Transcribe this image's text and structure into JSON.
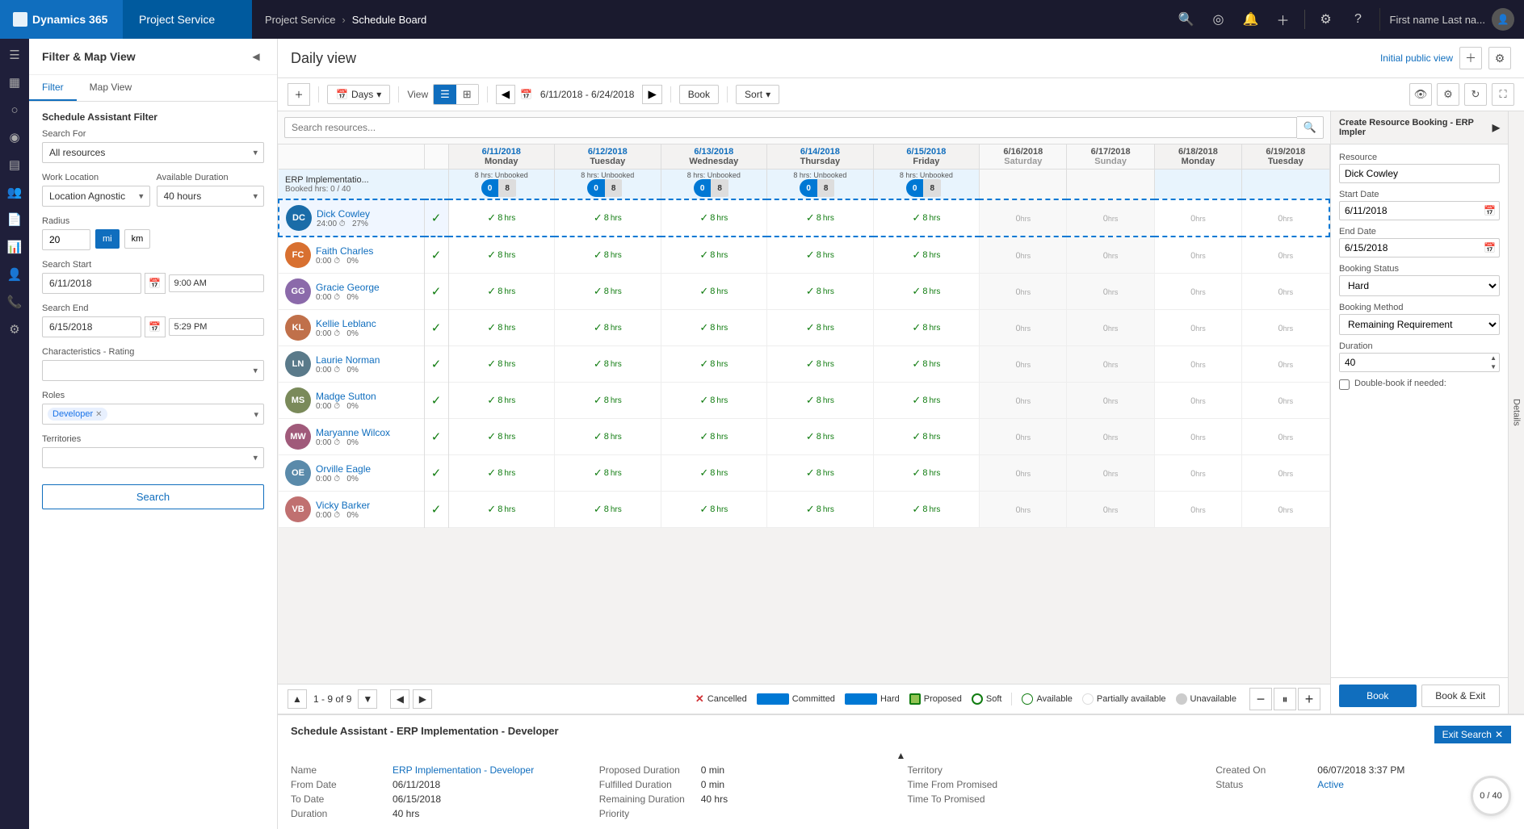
{
  "topnav": {
    "brand": "Dynamics 365",
    "app": "Project Service",
    "breadcrumb_app": "Project Service",
    "breadcrumb_sep": ">",
    "breadcrumb_page": "Schedule Board",
    "user": "First name Last na...",
    "icons": [
      "search",
      "settings",
      "question",
      "plus",
      "gear",
      "help"
    ]
  },
  "page": {
    "title": "Daily view",
    "initial_public": "Initial public view",
    "add_label": "+",
    "gear_label": "⚙"
  },
  "toolbar": {
    "days_label": "Days",
    "view_label": "View",
    "date_range": "6/11/2018 - 6/24/2018",
    "book_label": "Book",
    "sort_label": "Sort"
  },
  "filter_panel": {
    "title": "Filter & Map View",
    "tab_filter": "Filter",
    "tab_map": "Map View",
    "section_title": "Schedule Assistant Filter",
    "search_for_label": "Search For",
    "search_for_value": "All resources",
    "work_location_label": "Work Location",
    "work_location_value": "Location Agnostic",
    "available_duration_label": "Available Duration",
    "available_duration_value": "40 hours",
    "radius_label": "Radius",
    "radius_value": "20",
    "radius_mi": "mi",
    "radius_km": "km",
    "search_start_label": "Search Start",
    "search_start_date": "6/11/2018",
    "search_start_time": "9:00 AM",
    "search_end_label": "Search End",
    "search_end_date": "6/15/2018",
    "search_end_time": "5:29 PM",
    "characteristics_label": "Characteristics - Rating",
    "roles_label": "Roles",
    "roles_tag": "Developer",
    "territories_label": "Territories",
    "search_btn": "Search"
  },
  "resources": {
    "search_placeholder": "Search resources...",
    "rows": [
      {
        "name": "Dick Cowley",
        "hours": "24:00",
        "pct": "27%",
        "color": "#1a6ca8",
        "avatar_text": "DC",
        "booked": "0",
        "total": "40"
      },
      {
        "name": "Faith Charles",
        "hours": "0:00",
        "pct": "0%",
        "color": "#d87030",
        "avatar_text": "FC"
      },
      {
        "name": "Gracie George",
        "hours": "0:00",
        "pct": "0%",
        "color": "#8B6AAA",
        "avatar_text": "GG"
      },
      {
        "name": "Kellie Leblanc",
        "hours": "0:00",
        "pct": "0%",
        "color": "#c0704a",
        "avatar_text": "KL"
      },
      {
        "name": "Laurie Norman",
        "hours": "0:00",
        "pct": "0%",
        "color": "#5a7a8a",
        "avatar_text": "LN"
      },
      {
        "name": "Madge Sutton",
        "hours": "0:00",
        "pct": "0%",
        "color": "#7a8a5a",
        "avatar_text": "MS"
      },
      {
        "name": "Maryanne Wilcox",
        "hours": "0:00",
        "pct": "0%",
        "color": "#a05a7a",
        "avatar_text": "MW"
      },
      {
        "name": "Orville Eagle",
        "hours": "0:00",
        "pct": "0%",
        "color": "#5a8aaa",
        "avatar_text": "OE"
      },
      {
        "name": "Vicky Barker",
        "hours": "0:00",
        "pct": "0%",
        "color": "#c07070",
        "avatar_text": "VB"
      }
    ]
  },
  "dates": [
    {
      "date": "6/11/2018",
      "weekday": "Monday",
      "unbooked": "8 hrs: Unbooked"
    },
    {
      "date": "6/12/2018",
      "weekday": "Tuesday",
      "unbooked": "8 hrs: Unbooked"
    },
    {
      "date": "6/13/2018",
      "weekday": "Wednesday",
      "unbooked": "8 hrs: Unbooked"
    },
    {
      "date": "6/14/2018",
      "weekday": "Thursday",
      "unbooked": "8 hrs: Unbooked"
    },
    {
      "date": "6/15/2018",
      "weekday": "Friday",
      "unbooked": "8 hrs: Unbooked"
    },
    {
      "date": "6/16/2018",
      "weekday": "Saturday",
      "unbooked": ""
    },
    {
      "date": "6/17/2018",
      "weekday": "Sunday",
      "unbooked": ""
    },
    {
      "date": "6/18/2018",
      "weekday": "Monday",
      "unbooked": ""
    },
    {
      "date": "6/19/2018",
      "weekday": "Tuesday",
      "unbooked": ""
    }
  ],
  "booking_header": {
    "erp_label": "ERP Implementatio...",
    "erp_sub": "Booked hrs: 0 / 40"
  },
  "booking_panel": {
    "title": "Create Resource Booking - ERP Impler",
    "resource_label": "Resource",
    "resource_value": "Dick Cowley",
    "start_date_label": "Start Date",
    "start_date_value": "6/11/2018",
    "end_date_label": "End Date",
    "end_date_value": "6/15/2018",
    "booking_status_label": "Booking Status",
    "booking_status_value": "Hard",
    "booking_method_label": "Booking Method",
    "booking_method_value": "Remaining Requirement",
    "duration_label": "Duration",
    "duration_value": "40",
    "double_book_label": "Double-book if needed:",
    "book_btn": "Book",
    "book_exit_btn": "Book & Exit"
  },
  "details_panel": {
    "label": "Details"
  },
  "pagination": {
    "range": "1 - 9 of 9"
  },
  "legend": {
    "cancelled": "Cancelled",
    "committed": "Committed",
    "hard": "Hard",
    "proposed": "Proposed",
    "soft": "Soft",
    "available": "Available",
    "partially": "Partially available",
    "unavailable": "Unavailable"
  },
  "bottom_panel": {
    "title": "Schedule Assistant - ERP Implementation - Developer",
    "exit_search": "Exit Search",
    "name_label": "Name",
    "name_value": "ERP Implementation - Developer",
    "from_date_label": "From Date",
    "from_date_value": "06/11/2018",
    "to_date_label": "To Date",
    "to_date_value": "06/15/2018",
    "duration_label": "Duration",
    "duration_value": "40 hrs",
    "proposed_duration_label": "Proposed Duration",
    "proposed_duration_value": "0 min",
    "fulfilled_duration_label": "Fulfilled Duration",
    "fulfilled_duration_value": "0 min",
    "remaining_duration_label": "Remaining Duration",
    "remaining_duration_value": "40 hrs",
    "priority_label": "Priority",
    "priority_value": "",
    "territory_label": "Territory",
    "territory_value": "",
    "time_from_promised_label": "Time From Promised",
    "time_from_promised_value": "",
    "time_to_promised_label": "Time To Promised",
    "time_to_promised_value": "",
    "created_on_label": "Created On",
    "created_on_value": "06/07/2018 3:37 PM",
    "status_label": "Status",
    "status_value": "Active",
    "progress_text": "0 / 40"
  },
  "bottom_search": {
    "btn_label": "Search"
  }
}
